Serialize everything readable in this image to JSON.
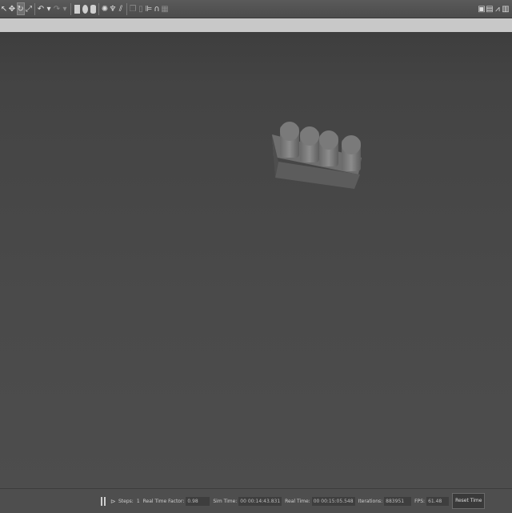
{
  "toolbar": {
    "tools": [
      {
        "name": "select-icon",
        "glyph": "↖"
      },
      {
        "name": "translate-icon",
        "glyph": "✥"
      },
      {
        "name": "rotate-icon",
        "glyph": "↻"
      },
      {
        "name": "scale-icon",
        "glyph": "⤢"
      }
    ],
    "history": [
      {
        "name": "undo-icon",
        "glyph": "↶"
      },
      {
        "name": "undo-dropdown-icon",
        "glyph": "▾"
      },
      {
        "name": "redo-icon",
        "glyph": "↷"
      },
      {
        "name": "redo-dropdown-icon",
        "glyph": "▾"
      }
    ],
    "shapes": [
      "box-shape-icon",
      "sphere-shape-icon",
      "cylinder-shape-icon"
    ],
    "lights": [
      {
        "name": "point-light-icon",
        "glyph": "✺"
      },
      {
        "name": "spot-light-icon",
        "glyph": "♆"
      },
      {
        "name": "directional-light-icon",
        "glyph": "⫽"
      }
    ],
    "tools2": [
      {
        "name": "copy-icon",
        "glyph": "❐"
      },
      {
        "name": "paste-icon",
        "glyph": "▯"
      },
      {
        "name": "align-icon",
        "glyph": "⊫"
      },
      {
        "name": "snap-icon",
        "glyph": "∩"
      },
      {
        "name": "screenshot-icon",
        "glyph": "▦"
      }
    ],
    "right": [
      {
        "name": "camera-icon",
        "glyph": "▣"
      },
      {
        "name": "record-video-icon",
        "glyph": "▤"
      },
      {
        "name": "plot-icon",
        "glyph": "⩘"
      },
      {
        "name": "log-icon",
        "glyph": "▥"
      }
    ]
  },
  "statusbar": {
    "steps_label": "Steps:",
    "steps_value": "1",
    "rtf_label": "Real Time Factor:",
    "rtf_value": "0.98",
    "sim_time_label": "Sim Time:",
    "sim_time_value": "00 00:14:43.831",
    "real_time_label": "Real Time:",
    "real_time_value": "00 00:15:05.548",
    "iterations_label": "Iterations:",
    "iterations_value": "883951",
    "fps_label": "FPS:",
    "fps_value": "61.48",
    "reset_label": "Reset Time"
  }
}
